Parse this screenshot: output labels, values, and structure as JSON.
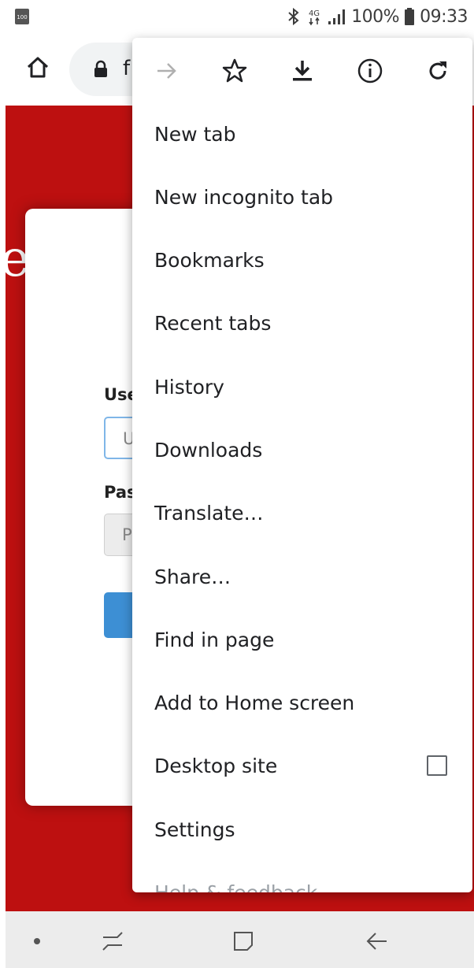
{
  "status_bar": {
    "battery_badge": "100",
    "network": "4G",
    "battery_percent": "100%",
    "time": "09:33"
  },
  "toolbar": {
    "url_visible_text": "f"
  },
  "page": {
    "edge_letter": "e",
    "login_form": {
      "username_label_visible": "Use",
      "username_placeholder_visible": "U",
      "password_label_visible": "Pas",
      "password_placeholder_visible": "P"
    }
  },
  "menu": {
    "icons": [
      "forward-icon",
      "bookmark-star-icon",
      "download-icon",
      "page-info-icon",
      "reload-icon"
    ],
    "items": [
      {
        "label": "New tab"
      },
      {
        "label": "New incognito tab"
      },
      {
        "label": "Bookmarks"
      },
      {
        "label": "Recent tabs"
      },
      {
        "label": "History"
      },
      {
        "label": "Downloads"
      },
      {
        "label": "Translate…"
      },
      {
        "label": "Share…"
      },
      {
        "label": "Find in page"
      },
      {
        "label": "Add to Home screen"
      },
      {
        "label": "Desktop site",
        "checkbox_checked": false
      },
      {
        "label": "Settings"
      },
      {
        "label": "Help & feedback"
      }
    ]
  },
  "colors": {
    "page_background": "#bd1010",
    "login_button": "#3d8fd4",
    "menu_background": "#ffffff",
    "nav_bar": "#ececec"
  }
}
